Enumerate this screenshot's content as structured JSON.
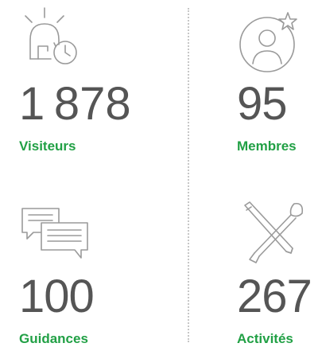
{
  "accent_color": "#21a045",
  "stats": {
    "visitors": {
      "value": "1 878",
      "label": "Visiteurs",
      "icon": "lamp-clock-icon"
    },
    "members": {
      "value": "95",
      "label": "Membres",
      "icon": "user-star-icon"
    },
    "guidances": {
      "value": "100",
      "label": "Guidances",
      "icon": "chat-bubbles-icon"
    },
    "activities": {
      "value": "267",
      "label": "Activités",
      "icon": "crossed-tools-icon"
    }
  }
}
